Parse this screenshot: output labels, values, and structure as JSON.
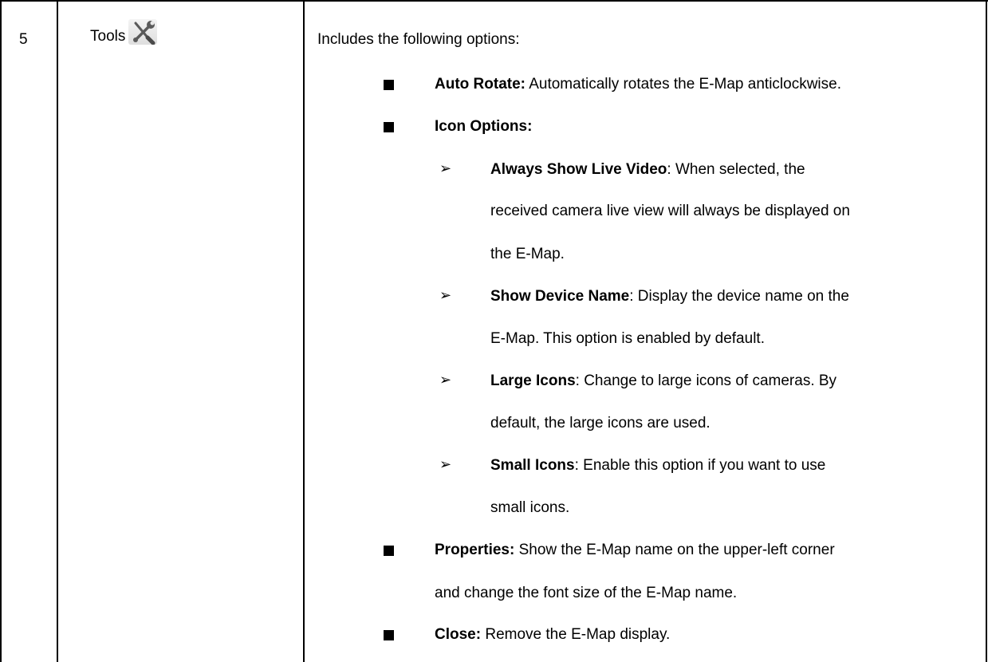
{
  "row": {
    "number": "5",
    "name": "Tools",
    "icon": "wrench-screwdriver-icon",
    "intro": "Includes the following options:",
    "bullets": [
      {
        "title": "Auto Rotate:",
        "lines": [
          " Automatically rotates the E-Map anticlockwise."
        ]
      },
      {
        "title": "Icon Options:",
        "lines": [],
        "subitems": [
          {
            "title": "Always Show Live Video",
            "line1": ": When selected, the",
            "line2": "received camera live view will always be displayed on",
            "line3": "the E-Map."
          },
          {
            "title": "Show Device Name",
            "line1": ": Display the device name on the",
            "line2": "E-Map. This option is enabled by default."
          },
          {
            "title": "Large Icons",
            "line1": ": Change to large icons of cameras. By",
            "line2": "default, the large icons are used."
          },
          {
            "title": "Small Icons",
            "line1": ": Enable this option if you want to use",
            "line2": "small icons."
          }
        ]
      },
      {
        "title": "Properties:",
        "lines": [
          " Show the E-Map name on the upper-left corner",
          "and change the font size of the E-Map name."
        ]
      },
      {
        "title": "Close:",
        "lines": [
          " Remove the E-Map display."
        ]
      }
    ]
  }
}
